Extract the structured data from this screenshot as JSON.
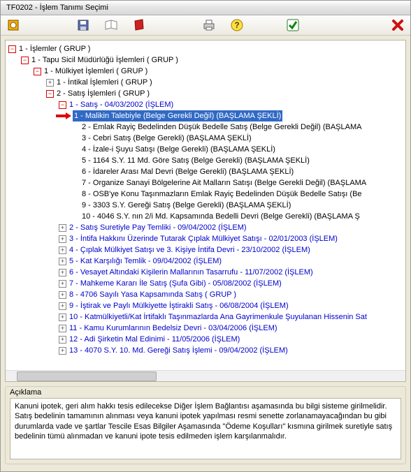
{
  "window": {
    "title": "TF0202 - İşlem Tanımı Seçimi"
  },
  "toolbar": {
    "icons": [
      "app-icon",
      "save-icon",
      "book-icon",
      "book-red-icon",
      "print-icon",
      "help-icon",
      "check-icon",
      "close-icon"
    ]
  },
  "tree": {
    "root": "1 - İşlemler ( GRUP )",
    "l1": "1 - Tapu Sicil Müdürlüğü İşlemleri ( GRUP )",
    "l2": "1 - Mülkiyet İşlemleri ( GRUP )",
    "intikal": "1 - İntikal İşlemleri ( GRUP )",
    "satis_grp": "2 - Satış İşlemleri ( GRUP )",
    "satis_islem": "1 - Satış - 04/03/2002 (İŞLEM)",
    "selected": "1 - Malikin Talebiyle (Belge Gerekli Değil) (BAŞLAMA ŞEKLİ)",
    "s2": "2 - Emlak Rayiç Bedelinden Düşük Bedelle Satış (Belge Gerekli Değil) (BAŞLAMA",
    "s3": "3 - Cebri Satış (Belge Gerekli) (BAŞLAMA ŞEKLİ)",
    "s4": "4 - İzale-i Şuyu Satışı (Belge Gerekli) (BAŞLAMA ŞEKLİ)",
    "s5": "5 - 1164 S.Y. 11 Md. Göre Satış (Belge Gerekli) (BAŞLAMA ŞEKLİ)",
    "s6": "6 - İdareler Arası Mal Devri (Belge Gerekli) (BAŞLAMA ŞEKLİ)",
    "s7": "7 - Organize Sanayi Bölgelerine Ait Malların Satışı (Belge Gerekli Değil) (BAŞLAMA",
    "s8": "8 - OSB'ye Konu Taşınmazların Emlak Rayiç Bedelinden Düşük Bedelle Satışı (Be",
    "s9": "9 - 3303 S.Y. Gereği Satış (Belge Gerekli) (BAŞLAMA ŞEKLİ)",
    "s10": "10 - 4046 S.Y. nın 2/i Md. Kapsamında Bedelli Devri (Belge Gerekli) (BAŞLAMA Ş",
    "n2": "2 - Satış Suretiyle Pay Temliki - 09/04/2002 (İŞLEM)",
    "n3": "3 - İntifa Hakkını Üzerinde Tutarak Çıplak Mülkiyet Satışı - 02/01/2003 (İŞLEM)",
    "n4": "4 - Çıplak Mülkiyet Satışı ve 3. Kişiye İntifa Devri - 23/10/2002 (İŞLEM)",
    "n5": "5 - Kat Karşılığı Temlik - 09/04/2002 (İŞLEM)",
    "n6": "6 - Vesayet Altındaki Kişilerin Mallarının Tasarrufu - 11/07/2002 (İŞLEM)",
    "n7": "7 - Mahkeme Kararı İle Satış (Şufa Gibi) - 05/08/2002 (İŞLEM)",
    "n8": "8 - 4706 Sayılı Yasa Kapsamında Satış ( GRUP )",
    "n9": "9 - İştirak ve Paylı Mülkiyette İştirakli Satış - 06/08/2004 (İŞLEM)",
    "n10": "10 - Katmülkiyetli/Kat İrtifaklı Taşınmazlarda Ana Gayrimenkule Şuyulanan Hissenin Sat",
    "n11": "11 - Kamu Kurumlarının Bedelsiz Devri - 03/04/2006 (İŞLEM)",
    "n12": "12 - Adi Şirketin Mal Edinimi - 11/05/2006 (İŞLEM)",
    "n13": "13 - 4070 S.Y. 10. Md. Gereği Satış İşlemi - 09/04/2002 (İŞLEM)"
  },
  "description": {
    "title": "Açıklama",
    "p1": "Kanuni ipotek, geri alım hakkı tesis edilecekse Diğer İşlem Bağlantısı aşamasında bu bilgi sisteme girilmelidir.",
    "p2": "Satış bedelinin tamamının alınması veya kanuni ipotek yapılması resmi senette zorlanamayacağından bu gibi durumlarda vade ve şartlar Tescile Esas Bilgiler Aşamasında \"Ödeme Koşulları\" kısmına girilmek suretiyle satış bedelinin tümü alınmadan ve kanuni ipote tesis edilmeden işlem karşılanmalıdır."
  }
}
